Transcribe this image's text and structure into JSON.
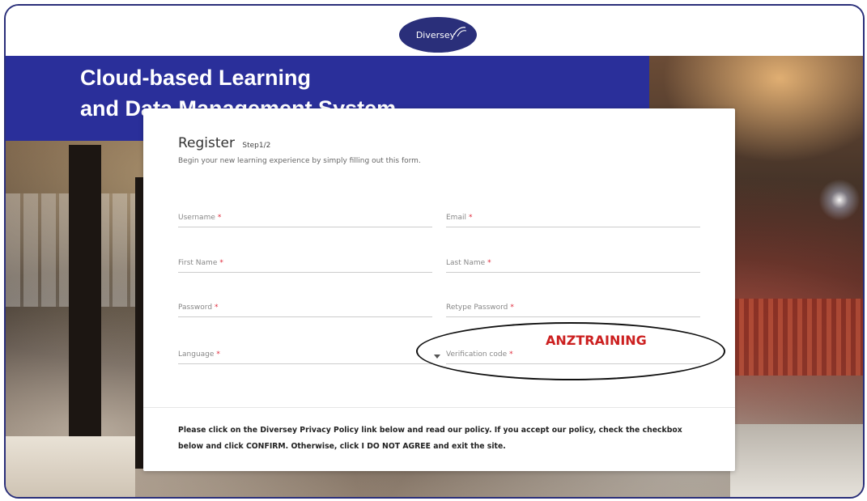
{
  "brand": {
    "logo_text": "Diversey"
  },
  "banner": {
    "title": "Cloud-based Learning\nand Data Management System"
  },
  "form": {
    "title": "Register",
    "step": "Step1/2",
    "subtitle": "Begin your new learning experience by simply filling out this form.",
    "fields": {
      "username": "Username",
      "email": "Email",
      "first_name": "First Name",
      "last_name": "Last Name",
      "password": "Password",
      "retype_password": "Retype Password",
      "language": "Language",
      "verification_code": "Verification code"
    },
    "required_marker": "*",
    "notice": "Please click on the Diversey Privacy Policy link below and read our policy. If you accept our policy, check the checkbox below and click CONFIRM. Otherwise, click I DO NOT AGREE and exit the site."
  },
  "annotation": {
    "text": "ANZTRAINING",
    "color": "#cc2020"
  },
  "colors": {
    "brand_blue": "#2a2f9a",
    "required_red": "#e0293a"
  }
}
